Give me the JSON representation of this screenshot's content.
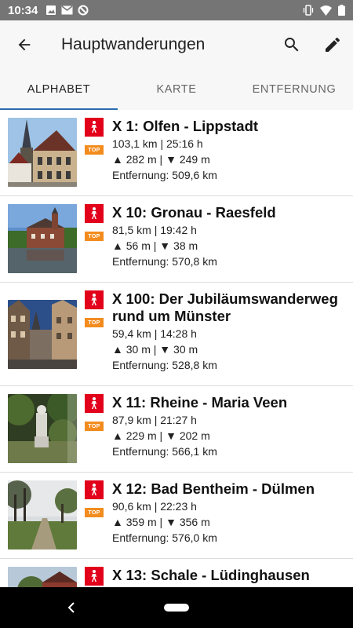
{
  "status": {
    "time": "10:34"
  },
  "app": {
    "title": "Hauptwanderungen"
  },
  "tabs": [
    {
      "label": "ALPHABET",
      "active": true
    },
    {
      "label": "KARTE",
      "active": false
    },
    {
      "label": "ENTFERNUNG",
      "active": false
    }
  ],
  "routes": [
    {
      "title": "X 1: Olfen - Lippstadt",
      "stats": "103,1 km | 25:16 h",
      "elevation": "▲ 282 m | ▼ 249 m",
      "distance": "Entfernung: 509,6 km",
      "badge": "TOP"
    },
    {
      "title": "X 10: Gronau - Raesfeld",
      "stats": "81,5 km | 19:42 h",
      "elevation": "▲ 56 m | ▼ 38 m",
      "distance": "Entfernung: 570,8 km",
      "badge": "TOP"
    },
    {
      "title": "X 100: Der Jubiläumswanderweg rund um Münster",
      "stats": "59,4 km | 14:28 h",
      "elevation": "▲ 30 m | ▼ 30 m",
      "distance": "Entfernung: 528,8 km",
      "badge": "TOP"
    },
    {
      "title": "X 11: Rheine - Maria Veen",
      "stats": "87,9 km | 21:27 h",
      "elevation": "▲ 229 m | ▼ 202 m",
      "distance": "Entfernung: 566,1 km",
      "badge": "TOP"
    },
    {
      "title": "X 12: Bad Bentheim - Dülmen",
      "stats": "90,6 km | 22:23 h",
      "elevation": "▲ 359 m | ▼ 356 m",
      "distance": "Entfernung: 576,0 km",
      "badge": "TOP"
    },
    {
      "title": "X 13: Schale - Lüdinghausen",
      "stats": "",
      "elevation": "",
      "distance": "",
      "badge": ""
    }
  ],
  "icons": {
    "back": "arrow-left-icon",
    "search": "search-icon",
    "edit": "pencil-icon",
    "hiking": "hiking-person-icon"
  },
  "colors": {
    "accent": "#2b6cb0",
    "hike_badge": "#e2001a",
    "top_badge": "#f28c1e",
    "status_bar": "#757575"
  }
}
